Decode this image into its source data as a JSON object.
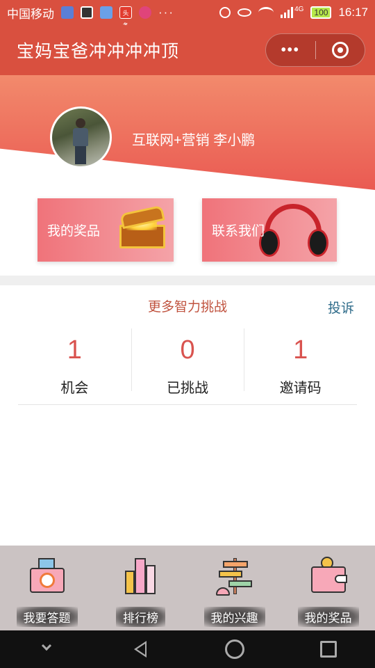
{
  "status_bar": {
    "carrier": "中国移动",
    "network": "4G",
    "battery": "100",
    "time": "16:17",
    "news_badge": "头条"
  },
  "navbar": {
    "title": "宝妈宝爸冲冲冲冲顶",
    "more_label": "•••"
  },
  "profile": {
    "username": "互联网+营销 李小鹏"
  },
  "cards": {
    "prizes": "我的奖品",
    "contact": "联系我们"
  },
  "challenge": {
    "title": "更多智力挑战",
    "complaint": "投诉",
    "stats": [
      {
        "value": "1",
        "label": "机会"
      },
      {
        "value": "0",
        "label": "已挑战"
      },
      {
        "value": "1",
        "label": "邀请码"
      }
    ]
  },
  "bottom_nav": [
    {
      "label": "我要答题",
      "icon": "camera-icon"
    },
    {
      "label": "排行榜",
      "icon": "ranking-chart-icon"
    },
    {
      "label": "我的兴趣",
      "icon": "signpost-icon"
    },
    {
      "label": "我的奖品",
      "icon": "wallet-icon"
    }
  ],
  "colors": {
    "brand_red": "#d9503f",
    "stat_number": "#d9534f",
    "complaint_link": "#2f6c8a"
  }
}
